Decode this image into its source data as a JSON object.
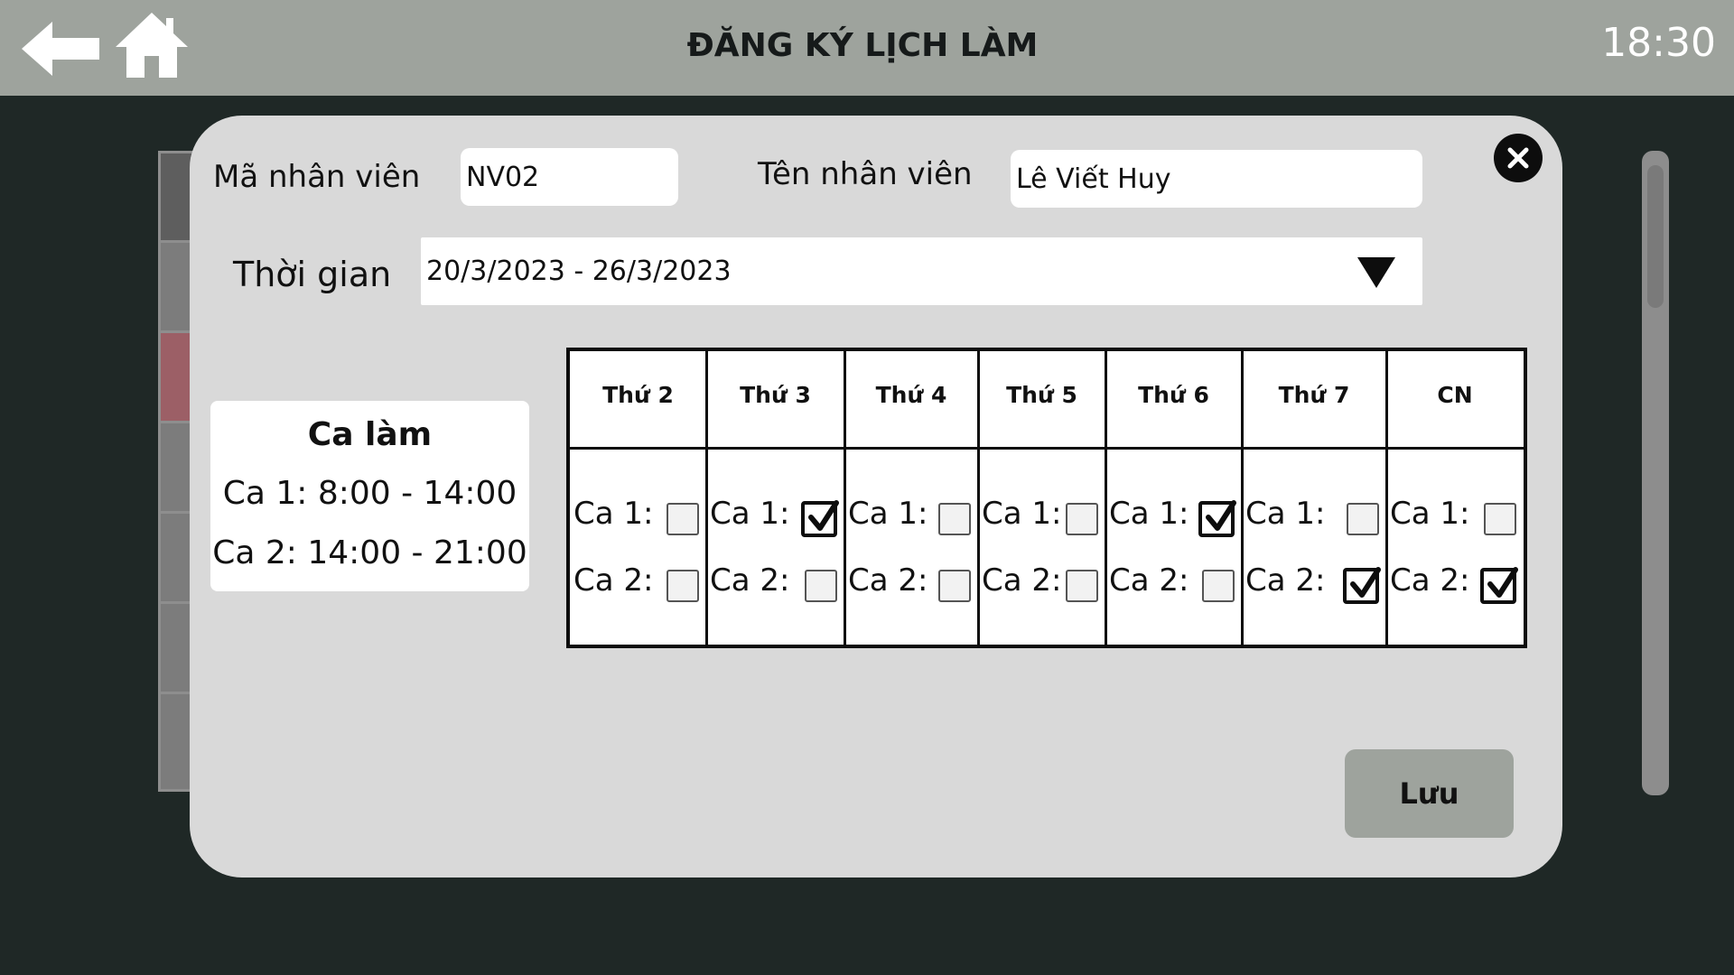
{
  "header": {
    "title": "ĐĂNG KÝ LỊCH LÀM",
    "time": "18:30",
    "back_icon": "arrow-left-icon",
    "home_icon": "home-icon"
  },
  "form": {
    "employee_id_label": "Mã nhân viên",
    "employee_id_value": "NV02",
    "employee_name_label": "Tên nhân viên",
    "employee_name_value": "Lê Viết Huy",
    "period_label": "Thời gian",
    "period_value": "20/3/2023 - 26/3/2023"
  },
  "shifts": {
    "title": "Ca làm",
    "shift1": "Ca 1: 8:00 - 14:00",
    "shift2": "Ca 2: 14:00 - 21:00"
  },
  "schedule": {
    "shift1_label": "Ca 1:",
    "shift2_label": "Ca 2:",
    "days": [
      {
        "name": "Thứ 2",
        "ca1": false,
        "ca2": false
      },
      {
        "name": "Thứ 3",
        "ca1": true,
        "ca2": false
      },
      {
        "name": "Thứ 4",
        "ca1": false,
        "ca2": false
      },
      {
        "name": "Thứ 5",
        "ca1": false,
        "ca2": false
      },
      {
        "name": "Thứ 6",
        "ca1": true,
        "ca2": false
      },
      {
        "name": "Thứ 7",
        "ca1": false,
        "ca2": true
      },
      {
        "name": "CN",
        "ca1": false,
        "ca2": true
      }
    ]
  },
  "actions": {
    "save_label": "Lưu",
    "close_icon": "close-icon"
  },
  "colors": {
    "header_bg": "#9ea39d",
    "page_bg": "#1f2826",
    "modal_bg": "#d9d9d9",
    "button_bg": "#9ea39d"
  }
}
